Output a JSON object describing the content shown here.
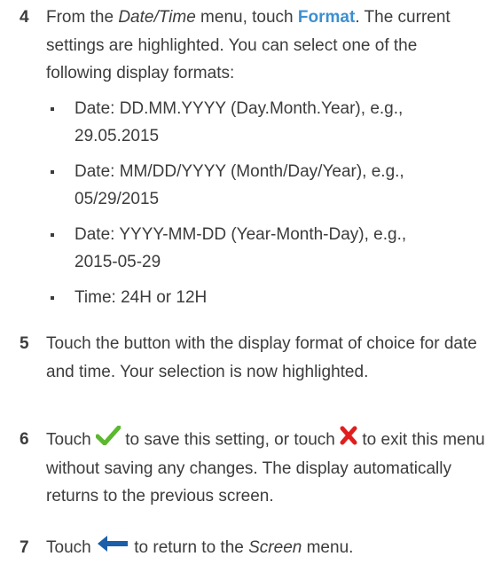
{
  "steps": [
    {
      "number": "4",
      "text_a": "From the ",
      "menu_name": "Date/Time",
      "text_b": " menu, touch ",
      "button_name": "Format",
      "text_c": ". The current settings are highlighted. You can select one of the following display formats:",
      "options": [
        {
          "line1": "Date: DD.MM.YYYY (Day.Month.Year), e.g.,",
          "line2": "29.05.2015"
        },
        {
          "line1": "Date: MM/DD/YYYY (Month/Day/Year), e.g.,",
          "line2": "05/29/2015"
        },
        {
          "line1": "Date: YYYY-MM-DD (Year-Month-Day), e.g.,",
          "line2": "2015-05-29"
        },
        {
          "line1": "Time: 24H or 12H",
          "line2": ""
        }
      ]
    },
    {
      "number": "5",
      "text": "Touch the button with the display format of choice for date and time. Your selection is now highlighted."
    },
    {
      "number": "6",
      "text_a": "Touch ",
      "icon_save": "checkmark-icon",
      "text_b": " to save this setting, or touch ",
      "icon_exit": "cross-icon",
      "text_c": " to exit this menu without saving any changes. The display automatically returns to the previous screen."
    },
    {
      "number": "7",
      "text_a": "Touch ",
      "icon_back": "back-arrow-icon",
      "text_b": " to return to the ",
      "menu_name": "Screen",
      "text_c": " menu."
    }
  ],
  "colors": {
    "text": "#3c3c3c",
    "highlight": "#3d8fd0",
    "check": "#5cb82e",
    "cross": "#e01e1e",
    "arrow": "#1d5ea8"
  }
}
